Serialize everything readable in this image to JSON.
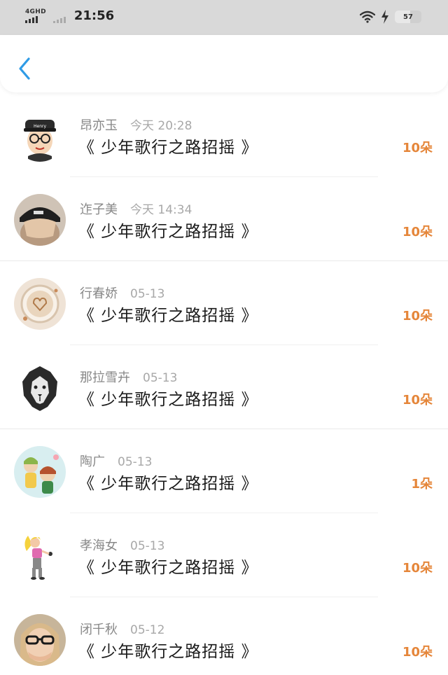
{
  "status_bar": {
    "network_label": "4GHD",
    "time": "21:56",
    "battery_level": "57",
    "battery_fraction": 0.57
  },
  "header": {
    "back_icon": "chevron-left-icon",
    "accent_color": "#2f9be6"
  },
  "list": {
    "amount_color": "#e5863a",
    "items": [
      {
        "user": "昂亦玉",
        "time": "今天 20:28",
        "title": "《 少年歌行之路招摇 》",
        "amount": "10朵"
      },
      {
        "user": "迮子美",
        "time": "今天 14:34",
        "title": "《 少年歌行之路招摇 》",
        "amount": "10朵"
      },
      {
        "user": "行春娇",
        "time": "05-13",
        "title": "《 少年歌行之路招摇 》",
        "amount": "10朵"
      },
      {
        "user": "那拉雪卉",
        "time": "05-13",
        "title": "《 少年歌行之路招摇 》",
        "amount": "10朵"
      },
      {
        "user": "陶广",
        "time": "05-13",
        "title": "《 少年歌行之路招摇 》",
        "amount": "1朵"
      },
      {
        "user": "孝海女",
        "time": "05-13",
        "title": "《 少年歌行之路招摇 》",
        "amount": "10朵"
      },
      {
        "user": "闭千秋",
        "time": "05-12",
        "title": "《 少年歌行之路招摇 》",
        "amount": "10朵"
      }
    ]
  }
}
